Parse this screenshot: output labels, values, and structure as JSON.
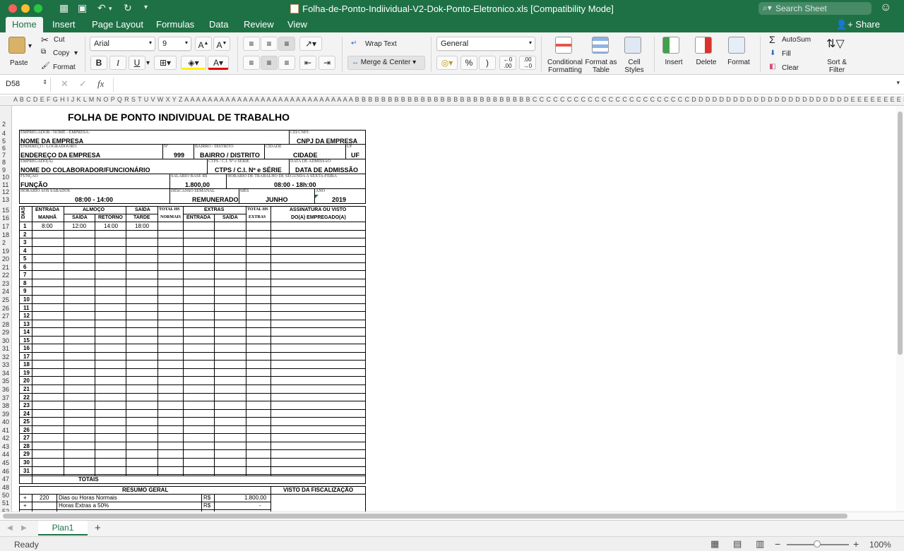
{
  "window": {
    "title": "Folha-de-Ponto-Indiividual-V2-Dok-Ponto-Eletronico.xls  [Compatibility Mode]",
    "search_placeholder": "Search Sheet"
  },
  "tabs": [
    "Home",
    "Insert",
    "Page Layout",
    "Formulas",
    "Data",
    "Review",
    "View"
  ],
  "share_label": "Share",
  "ribbon": {
    "paste": "Paste",
    "cut": "Cut",
    "copy": "Copy",
    "format": "Format",
    "font_name": "Arial",
    "font_size": "9",
    "wrap_text": "Wrap Text",
    "merge_center": "Merge & Center",
    "number_format": "General",
    "conditional_formatting": "Conditional Formatting",
    "format_as_table": "Format as Table",
    "cell_styles": "Cell Styles",
    "insert": "Insert",
    "delete": "Delete",
    "format_cells": "Format",
    "autosum": "AutoSum",
    "fill": "Fill",
    "clear": "Clear",
    "sort_filter": "Sort & Filter"
  },
  "formula_bar": {
    "name_box": "D58",
    "formula": ""
  },
  "column_headers": "A B C D E F G H  I  J  K  L  M N  O  P  Q  R  S  T  U  V  W X  Y  Z A A A A A A A A A A A A A A A A A A A A A A A A A A A A A B B B B B B B B B B B B B B B B B B B B B B B B B B B C C C C C C C C C C C C C C C C C C C C C C C D D D D D D D D D D D D D D D D D D D D D D D E E E E E E E E E",
  "row_numbers": [
    "2",
    "4",
    "5",
    "6",
    "7",
    "8",
    "9",
    "10",
    "11",
    "12",
    "13",
    "15",
    "16",
    "17",
    "18",
    "2",
    "19",
    "20",
    "21",
    "22",
    "23",
    "24",
    "25",
    "26",
    "27",
    "28",
    "29",
    "30",
    "31",
    "32",
    "33",
    "34",
    "35",
    "36",
    "37",
    "38",
    "39",
    "40",
    "41",
    "42",
    "43",
    "44",
    "45",
    "46",
    "47",
    "48",
    "50",
    "51",
    "52"
  ],
  "sheet": {
    "title": "FOLHA DE PONTO INDIVIDUAL DE TRABALHO",
    "lbl_empregador": "EMPREGADOR / NOME - EMPRESA:",
    "val_empregador": "NOME DA EMPRESA",
    "lbl_cei": "CEI/CNPJ:",
    "val_cei": "CNPJ DA EMPRESA",
    "lbl_endereco": "ENDEREÇO / LOGRADOURO:",
    "val_endereco": "ENDEREÇO DA EMPRESA",
    "lbl_num": "Nº",
    "val_num": "999",
    "lbl_bairro": "BAIRRO / DISTRITO",
    "val_bairro": "BAIRRO / DISTRITO",
    "lbl_cidade": "CIDADE",
    "val_cidade": "CIDADE",
    "lbl_uf": "UF",
    "val_uf": "UF",
    "lbl_empregado": "EMPREGADO(A)",
    "val_empregado": "NOME DO COLABORADOR/FUNCIONÁRIO",
    "lbl_ctps": "CTPS / C.I. Nº e SÉRIE",
    "val_ctps": "CTPS / C.I. Nº e SÉRIE",
    "lbl_admissao": "DATA DE ADMISSÃO",
    "val_admissao": "DATA DE ADMISSÃO",
    "lbl_funcao": "FUNÇÃO",
    "val_funcao": "FUNÇÃO",
    "lbl_salario": "SALÁRIO BASE R$",
    "val_salario": "1.800,00",
    "lbl_horario": "HORÁRIO DE TRABALHO DE SEGUNDA A SEXTA-FEIRA",
    "val_horario": "08:00 - 18h:00",
    "lbl_sabados": "HORÁRIO AOS SÁBADOS",
    "val_sabados": "08:00 - 14:00",
    "lbl_descanso": "DESCANSO SEMANAL",
    "val_descanso": "REMUNERADO",
    "lbl_mes": "MÊS",
    "val_mes": "JUNHO",
    "lbl_ano": "ANO",
    "val_ano": "2019",
    "h_dias": "DIAS",
    "h_entrada": "ENTRADA",
    "h_manha": "MANHÃ",
    "h_almoco": "ALMOÇO",
    "h_saida": "SAÍDA",
    "h_retorno": "RETORNO",
    "h_saida2": "SAÍDA",
    "h_tarde": "TARDE",
    "h_total1": "TOTAL HS",
    "h_normais": "NORMAIS",
    "h_extras": "EXTRAS",
    "h_entrada2": "ENTRADA",
    "h_saida3": "SAÍDA",
    "h_total2": "TOTAL HS",
    "h_extras2": "EXTRAS",
    "h_assinatura": "ASSINATURA OU VISTO",
    "h_assinatura2": "DO(A) EMPREGADO(A)",
    "r1_entrada": "8:00",
    "r1_saida": "12:00",
    "r1_retorno": "14:00",
    "r1_tarde": "18:00",
    "days": [
      "1",
      "2",
      "3",
      "4",
      "5",
      "6",
      "7",
      "8",
      "9",
      "10",
      "11",
      "12",
      "13",
      "14",
      "15",
      "16",
      "17",
      "18",
      "19",
      "20",
      "21",
      "22",
      "23",
      "24",
      "25",
      "26",
      "27",
      "28",
      "29",
      "30",
      "31"
    ],
    "totais": "TOTAIS",
    "resumo": "RESUMO GERAL",
    "visto": "VISTO DA FISCALIZAÇÃO",
    "res1_sign": "+",
    "res1_qty": "220",
    "res1_desc": "Dias ou Horas Normais",
    "res1_cur": "R$",
    "res1_val": "1.800,00",
    "res2_sign": "+",
    "res2_desc": "Horas Extras a 50%",
    "res2_cur": "R$",
    "res2_val": "-"
  },
  "sheet_tab": "Plan1",
  "status": {
    "text": "Ready",
    "zoom": "100%"
  }
}
